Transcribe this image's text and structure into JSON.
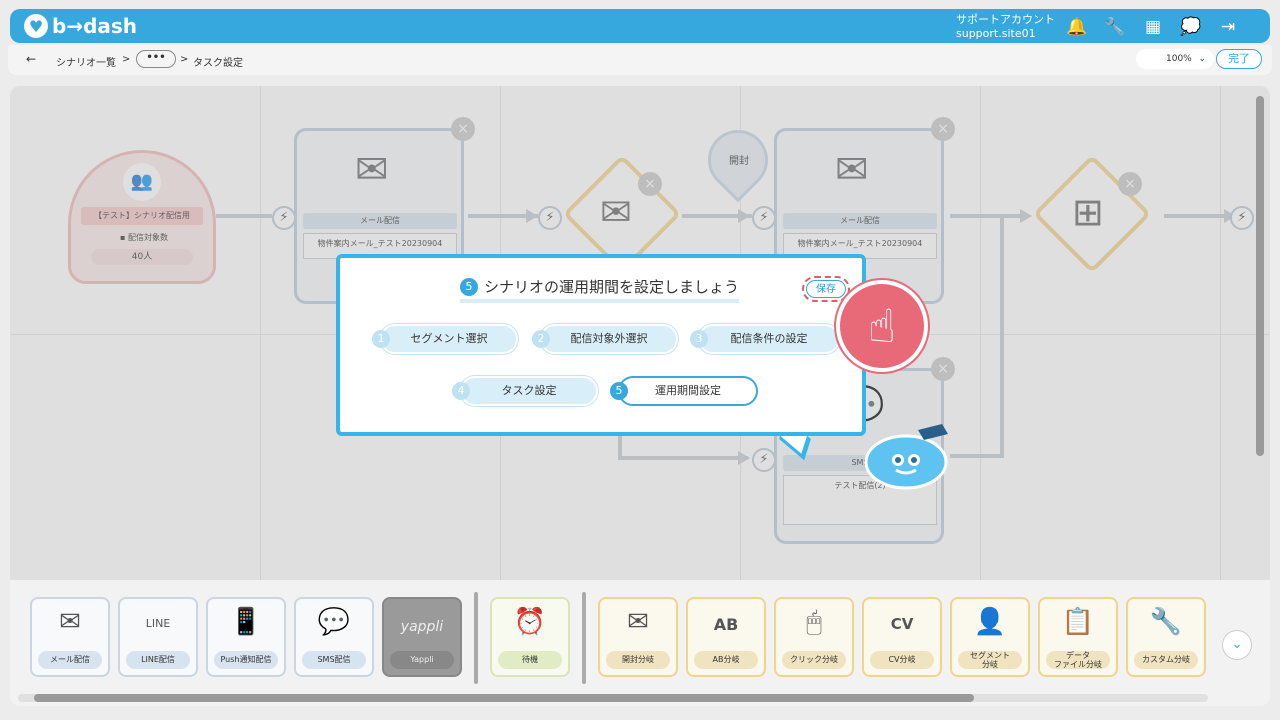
{
  "header": {
    "logo_text": "b→dash",
    "account_name": "サポートアカウント",
    "account_site": "support.site01",
    "icons": [
      "bell-icon",
      "wrench-icon",
      "grid-icon",
      "chat-icon",
      "logout-icon"
    ],
    "color": "#36a8dd"
  },
  "breadcrumb": {
    "back": "←",
    "item1": "シナリオ一覧",
    "sep": ">",
    "dots": "•••",
    "current": "タスク設定",
    "zoom": "100%",
    "zoom_caret": "⌄",
    "done": "完了"
  },
  "canvas": {
    "start": {
      "title": "【テスト】シナリオ配信用",
      "sub": "配信対象数",
      "count": "40人"
    },
    "mail1": {
      "type": "メール配信",
      "name": "物件案内メール_テスト20230904"
    },
    "mail2": {
      "type": "メール配信",
      "name": "物件案内メール_テスト20230904"
    },
    "sms": {
      "type": "SMS",
      "name": "テスト配信(2)"
    },
    "open_pin": "開封",
    "close": "×",
    "bolt": "⚡"
  },
  "modal": {
    "step_number": "5",
    "title": "シナリオの運用期間を設定しましょう",
    "save": "保存",
    "steps": [
      {
        "num": "1",
        "label": "セグメント選択"
      },
      {
        "num": "2",
        "label": "配信対象外選択"
      },
      {
        "num": "3",
        "label": "配信条件の設定"
      },
      {
        "num": "4",
        "label": "タスク設定"
      },
      {
        "num": "5",
        "label": "運用期間設定"
      }
    ],
    "accent": "#36b4ec"
  },
  "toolbar": {
    "items": [
      {
        "label": "メール配信",
        "icon": "✉"
      },
      {
        "label": "LINE配信",
        "icon": "LINE"
      },
      {
        "label": "Push通知配信",
        "icon": "📱"
      },
      {
        "label": "SMS配信",
        "icon": "💬"
      },
      {
        "label": "Yappli",
        "icon": "yappli"
      },
      {
        "label": "待機",
        "icon": "⏰"
      },
      {
        "label": "開封分岐",
        "icon": "✉"
      },
      {
        "label": "AB分岐",
        "icon": "AB"
      },
      {
        "label": "クリック分岐",
        "icon": "🖱"
      },
      {
        "label": "CV分岐",
        "icon": "CV"
      },
      {
        "label": "セグメント分岐",
        "line1": "セグメント",
        "line2": "分岐",
        "icon": "👤"
      },
      {
        "label": "データファイル分岐",
        "line1": "データ",
        "line2": "ファイル分岐",
        "icon": "📋"
      },
      {
        "label": "カスタム分岐",
        "icon": "🔧"
      }
    ],
    "expand": "⌄"
  }
}
